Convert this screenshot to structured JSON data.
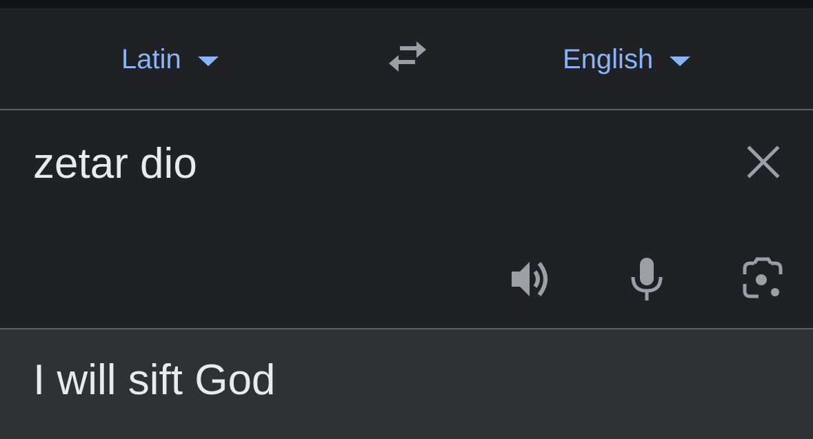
{
  "language_bar": {
    "source_language": "Latin",
    "target_language": "English",
    "swap_icon": "swap-arrows-icon"
  },
  "input": {
    "text": "zetar dio",
    "clear_icon": "close-icon",
    "tools": [
      "speaker-icon",
      "microphone-icon",
      "camera-lens-icon"
    ]
  },
  "output": {
    "translation": "I will sift God"
  },
  "colors": {
    "background": "#202124",
    "output_background": "#303134",
    "accent": "#8ab4f8",
    "text": "#e8eaed",
    "icon": "#9aa0a6",
    "divider": "#5f6368"
  }
}
